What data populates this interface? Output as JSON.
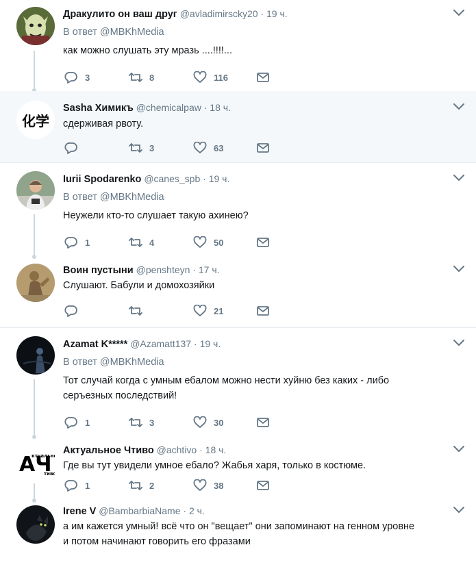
{
  "tweets": [
    {
      "name": "Дракулито он ваш друг",
      "handle": "@avladimirscky20",
      "time": "19 ч.",
      "reply_label": "В ответ",
      "reply_to": "@MBKhMedia",
      "text": "как можно слушать эту мразь ....!!!!...",
      "replies": "3",
      "retweets": "8",
      "likes": "116",
      "avatar_icon": "dracula-avatar"
    },
    {
      "name": "Sasha Химикъ",
      "handle": "@chemicalpaw",
      "time": "18 ч.",
      "text": "сдерживая рвоту.",
      "replies": "",
      "retweets": "3",
      "likes": "63",
      "avatar_icon": "kanji-avatar",
      "avatar_text": "化学"
    },
    {
      "name": "Iurii Spodarenko",
      "handle": "@canes_spb",
      "time": "19 ч.",
      "reply_label": "В ответ",
      "reply_to": "@MBKhMedia",
      "text": "Неужели кто-то слушает такую ахинею?",
      "replies": "1",
      "retweets": "4",
      "likes": "50",
      "avatar_icon": "person-avatar"
    },
    {
      "name": "Воин пустыни",
      "handle": "@penshteyn",
      "time": "17 ч.",
      "text": "Слушают. Бабули и домохозяйки",
      "replies": "",
      "retweets": "",
      "likes": "21",
      "avatar_icon": "statue-avatar"
    },
    {
      "name": "Azamat K*****",
      "handle": "@Azamatt137",
      "time": "19 ч.",
      "reply_label": "В ответ",
      "reply_to": "@MBKhMedia",
      "text_line1": "Тот случай когда с умным ебалом можно нести хуйню без каких - либо",
      "text_line2": "серъезных последствий!",
      "replies": "1",
      "retweets": "3",
      "likes": "30",
      "avatar_icon": "dark-figure-avatar"
    },
    {
      "name": "Актуальное Чтиво",
      "handle": "@achtivo",
      "time": "18 ч.",
      "text": "Где вы тут увидели умное ебало? Жабья харя, только в костюме.",
      "replies": "1",
      "retweets": "2",
      "likes": "38",
      "avatar_icon": "ach-logo-avatar",
      "logo_big": "АЧ",
      "logo_small1": "ктуальное",
      "logo_small2": "тиво"
    },
    {
      "name": "Irene V",
      "handle": "@BambarbiaName",
      "time": "2 ч.",
      "text_line1": "а им кажется умный! всё что он \"вещает\" они запоминают на генном уровне",
      "text_line2": "и потом начинают говорить его фразами",
      "avatar_icon": "cat-avatar"
    }
  ],
  "dot": "·",
  "colors": {
    "text": "#14171a",
    "muted": "#657786",
    "highlight_bg": "#f5f8fa",
    "border": "#e6ecf0"
  }
}
